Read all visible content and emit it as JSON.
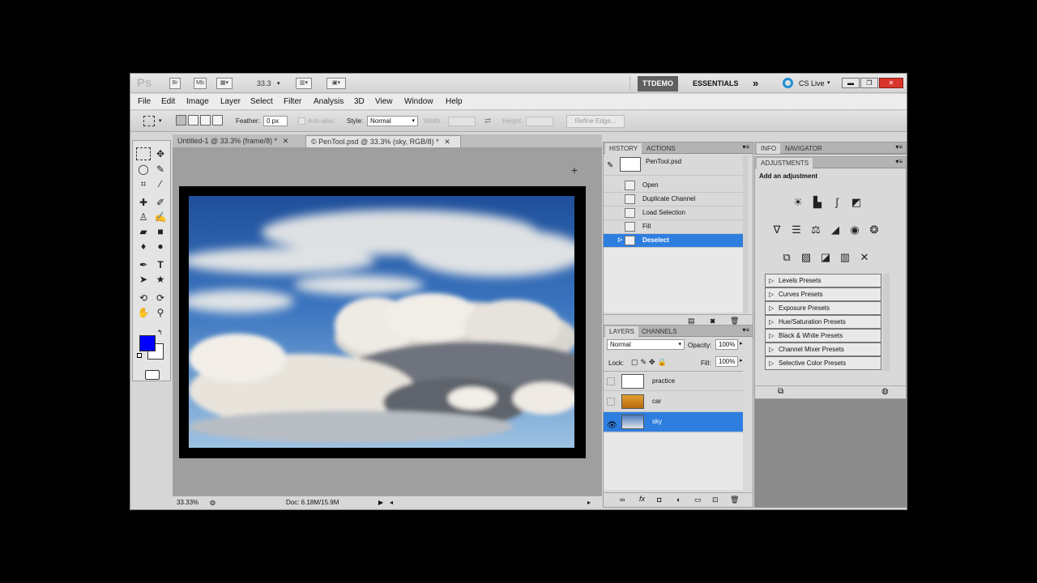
{
  "appbar": {
    "logo": "Ps",
    "br_label": "Br",
    "mb_label": "Mb",
    "zoom": "33.3",
    "workspace_active": "TTDEMO",
    "workspace_essentials": "ESSENTIALS",
    "more": "»",
    "cs_live": "CS Live"
  },
  "menu": [
    "File",
    "Edit",
    "Image",
    "Layer",
    "Select",
    "Filter",
    "Analysis",
    "3D",
    "View",
    "Window",
    "Help"
  ],
  "options": {
    "feather_label": "Feather:",
    "feather_value": "0 px",
    "antialias_label": "Anti-alias",
    "style_label": "Style:",
    "style_value": "Normal",
    "width_label": "Width:",
    "height_label": "Height:",
    "refine_label": "Refine Edge..."
  },
  "tabs": [
    "Untitled-1 @ 33.3% (frame/8) *",
    "© PenTool.psd @ 33.3% (sky, RGB/8) *"
  ],
  "status": {
    "zoom": "33.33%",
    "doc": "Doc: 6.18M/15.9M"
  },
  "history": {
    "tab_history": "HISTORY",
    "tab_actions": "ACTIONS",
    "snapshot": "PenTool.psd",
    "items": [
      "Open",
      "Duplicate Channel",
      "Load Selection",
      "Fill",
      "Deselect"
    ]
  },
  "layers": {
    "tab_layers": "LAYERS",
    "tab_channels": "CHANNELS",
    "blend_mode": "Normal",
    "opacity_label": "Opacity:",
    "opacity_value": "100%",
    "lock_label": "Lock:",
    "fill_label": "Fill:",
    "fill_value": "100%",
    "items": [
      "practice",
      "car",
      "sky"
    ]
  },
  "info_panel": {
    "tab_info": "INFO",
    "tab_navigator": "NAVIGATOR"
  },
  "adjustments": {
    "tab": "ADJUSTMENTS",
    "title": "Add an adjustment",
    "presets": [
      "Levels Presets",
      "Curves Presets",
      "Exposure Presets",
      "Hue/Saturation Presets",
      "Black & White Presets",
      "Channel Mixer Presets",
      "Selective Color Presets"
    ]
  },
  "colors": {
    "foreground": "#0000ff",
    "background": "#ffffff",
    "selection": "#2e7ee0"
  }
}
